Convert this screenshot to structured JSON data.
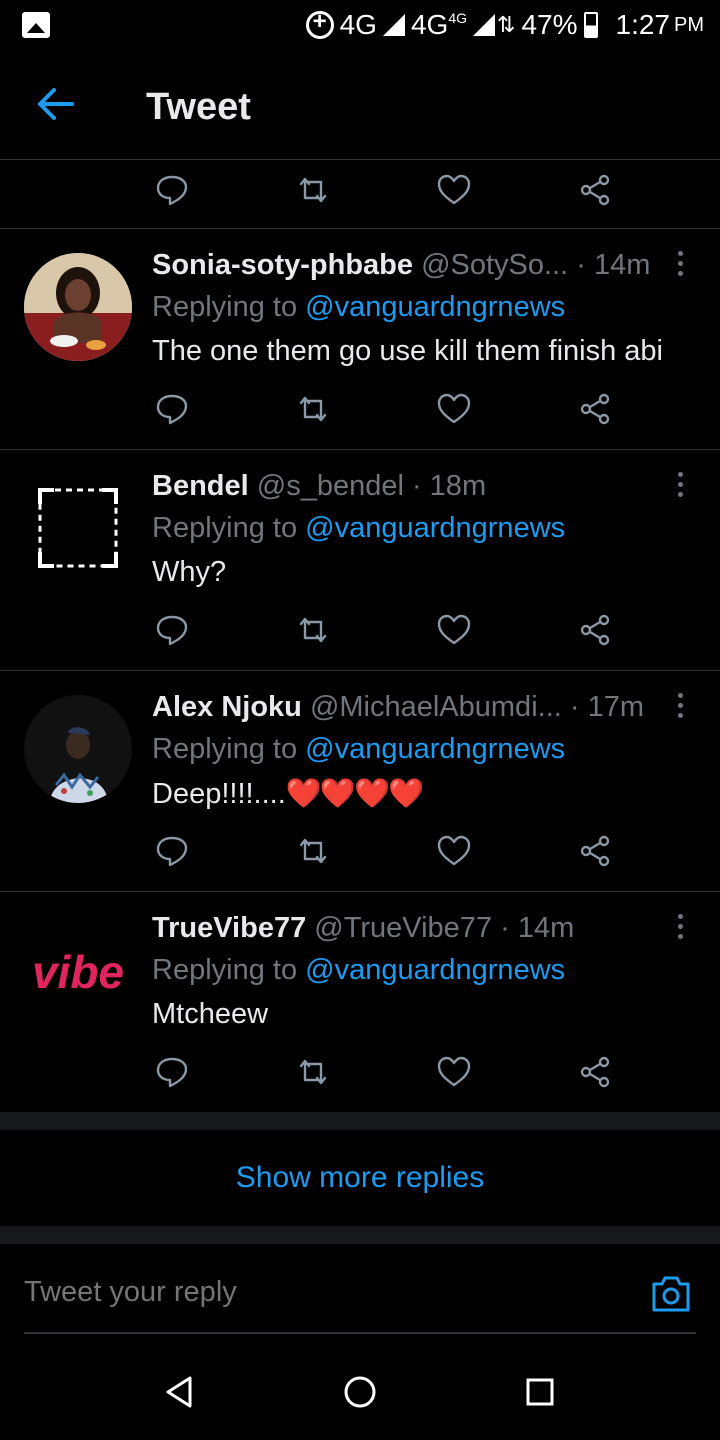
{
  "status_bar": {
    "network_1": "4G",
    "network_2": "4G",
    "network_2_sup": "4G",
    "battery": "47%",
    "time": "1:27",
    "ampm": "PM"
  },
  "header": {
    "title": "Tweet"
  },
  "colors": {
    "accent": "#1d9bf0",
    "muted": "#71767b",
    "text": "#e7e9ea",
    "background": "#000000",
    "divider": "#2f3336"
  },
  "tweets": [
    {
      "name": "Sonia-soty-phbabe",
      "handle": "@SotySo...",
      "time": "· 14m",
      "replying_prefix": "Replying to ",
      "mention": "@vanguardngrnews",
      "text": "The one them go use kill them finish abi",
      "avatar": "photo-avatar"
    },
    {
      "name": "Bendel",
      "handle": "@s_bendel",
      "time": "· 18m",
      "replying_prefix": "Replying to ",
      "mention": "@vanguardngrnews",
      "text": "Why?",
      "avatar": "placeholder-avatar"
    },
    {
      "name": "Alex Njoku",
      "handle": "@MichaelAbumdi...",
      "time": "· 17m",
      "replying_prefix": "Replying to ",
      "mention": "@vanguardngrnews",
      "text": "Deep!!!!....",
      "emoji": "❤️❤️❤️❤️",
      "avatar": "photo-avatar"
    },
    {
      "name": "TrueVibe77",
      "handle": "@TrueVibe77",
      "time": "· 14m",
      "replying_prefix": "Replying to ",
      "mention": "@vanguardngrnews",
      "text": "Mtcheew",
      "avatar": "logo-avatar",
      "avatar_logo_text": "vibe"
    }
  ],
  "show_more": "Show more replies",
  "reply_box": {
    "placeholder": "Tweet your reply"
  },
  "icons": {
    "reply": "reply-icon",
    "retweet": "retweet-icon",
    "like": "like-icon",
    "share": "share-icon",
    "back": "back-arrow-icon",
    "camera": "camera-icon",
    "more": "more-vertical-icon"
  }
}
